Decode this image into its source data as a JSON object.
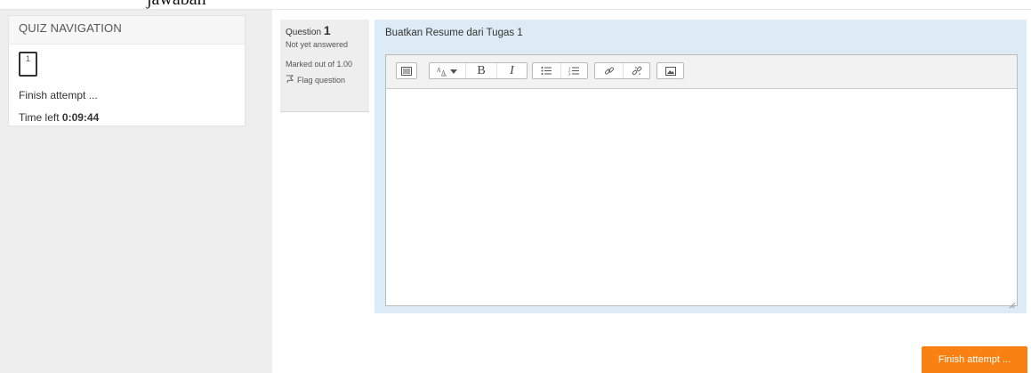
{
  "page_top_text": "jawaban",
  "quiz_navigation": {
    "title": "QUIZ NAVIGATION",
    "question_buttons": [
      {
        "number": "1"
      }
    ],
    "finish_link": "Finish attempt ...",
    "time_left_label": "Time left ",
    "time_left_value": "0:09:44"
  },
  "question_info": {
    "label": "Question ",
    "number": "1",
    "state": "Not yet answered",
    "grade": "Marked out of 1.00",
    "flag_label": "Flag question"
  },
  "question": {
    "text": "Buatkan Resume dari Tugas 1",
    "answer_value": ""
  },
  "toolbar": {
    "icons": [
      "toggle-toolbar-icon",
      "font-style-icon",
      "bold-icon",
      "italic-icon",
      "unordered-list-icon",
      "ordered-list-icon",
      "link-icon",
      "unlink-icon",
      "image-icon"
    ],
    "bold_label": "B",
    "italic_label": "I"
  },
  "footer": {
    "finish_button_label": "Finish attempt ..."
  },
  "colors": {
    "accent": "#f98012",
    "content_background": "#dcebf5",
    "sidebar_background": "#eeeeee"
  }
}
